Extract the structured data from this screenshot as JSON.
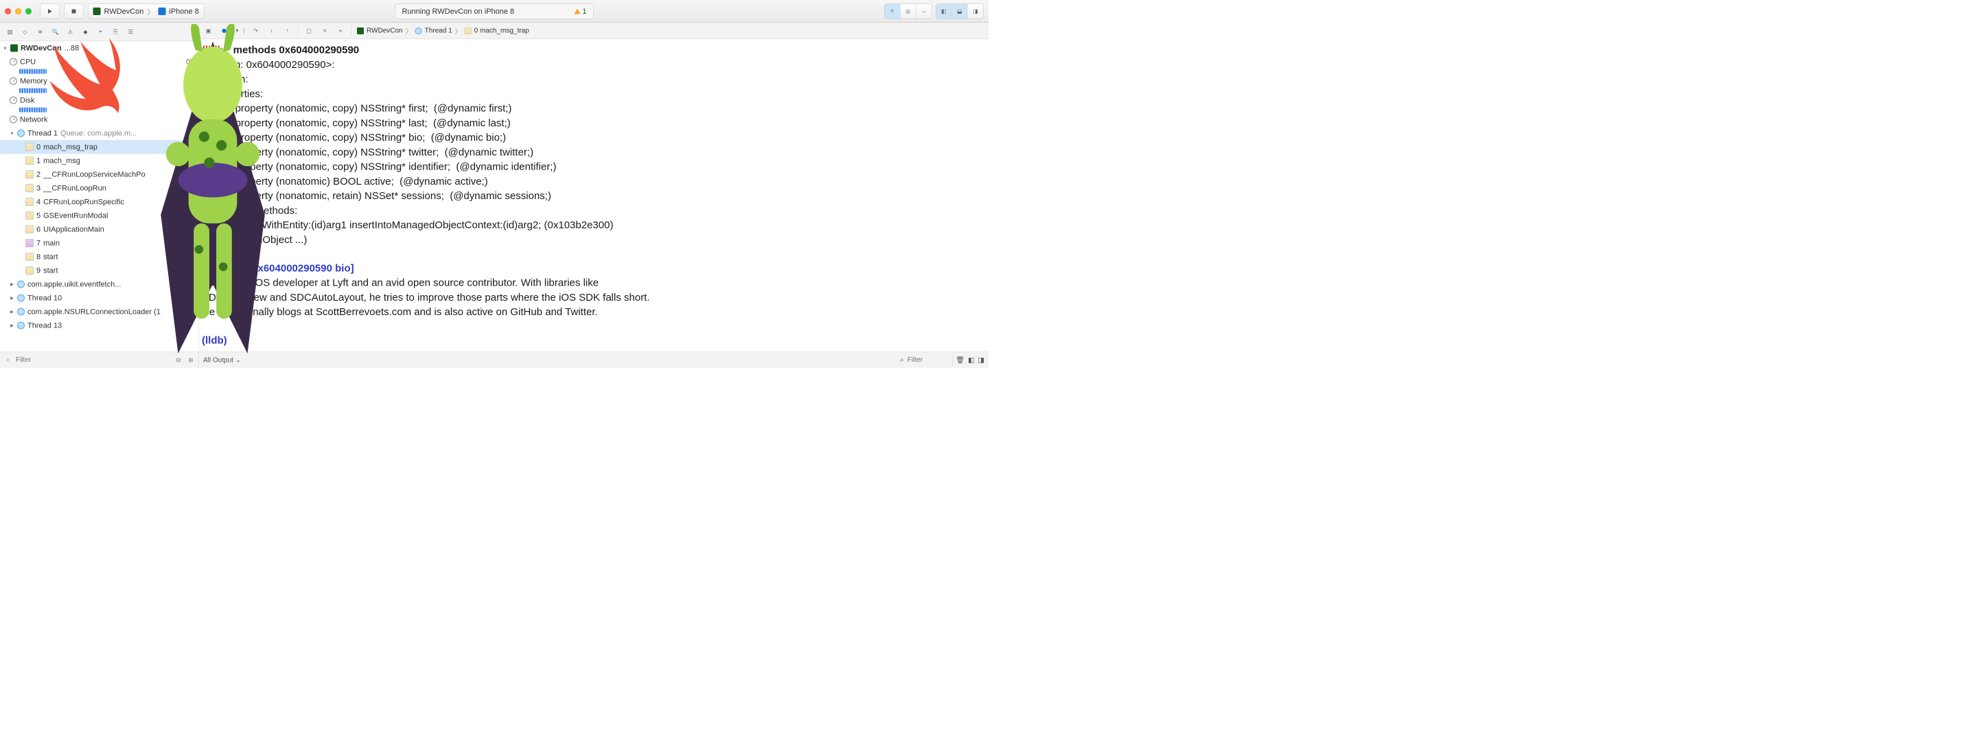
{
  "toolbar": {
    "scheme_app": "RWDevCon",
    "scheme_device": "iPhone 8",
    "activity": "Running RWDevCon on iPhone 8",
    "warning_count": "1"
  },
  "nav": {
    "root": "RWDevCon",
    "root_pid_suffix": "...88",
    "gauges": {
      "cpu": {
        "label": "CPU",
        "value": "0%"
      },
      "memory": {
        "label": "Memory",
        "value": "MB"
      },
      "disk": {
        "label": "Disk"
      },
      "network": {
        "label": "Network"
      }
    },
    "thread1": {
      "label": "Thread 1",
      "queue": "Queue: com.apple.m..."
    },
    "frames": [
      {
        "n": "0",
        "name": "mach_msg_trap",
        "sel": true,
        "user": false
      },
      {
        "n": "1",
        "name": "mach_msg",
        "user": false
      },
      {
        "n": "2",
        "name": "__CFRunLoopServiceMachPo",
        "user": false
      },
      {
        "n": "3",
        "name": "__CFRunLoopRun",
        "user": false
      },
      {
        "n": "4",
        "name": "CFRunLoopRunSpecific",
        "user": false
      },
      {
        "n": "5",
        "name": "GSEventRunModal",
        "user": false
      },
      {
        "n": "6",
        "name": "UIApplicationMain",
        "user": false
      },
      {
        "n": "7",
        "name": "main",
        "user": true
      },
      {
        "n": "8",
        "name": "start",
        "user": false
      },
      {
        "n": "9",
        "name": "start",
        "user": false
      }
    ],
    "other_threads": [
      "com.apple.uikit.eventfetch...",
      "Thread 10",
      "com.apple.NSURLConnectionLoader (1",
      "Thread 13"
    ],
    "filter_placeholder": "Filter"
  },
  "jumpbar": {
    "app": "RWDevCon",
    "thread": "Thread 1",
    "frame": "0 mach_msg_trap"
  },
  "console": {
    "prompt": "(lldb)",
    "cmd1": "methods 0x604000290590",
    "out": "<Person: 0x604000290590>:\nin Person:\n    Properties:\n        @property (nonatomic, copy) NSString* first;  (@dynamic first;)\n        @property (nonatomic, copy) NSString* last;  (@dynamic last;)\n        @property (nonatomic, copy) NSString* bio;  (@dynamic bio;)\n        @property (nonatomic, copy) NSString* twitter;  (@dynamic twitter;)\n        @property (nonatomic, copy) NSString* identifier;  (@dynamic identifier;)\n        @property (nonatomic) BOOL active;  (@dynamic active;)\n        @property (nonatomic, retain) NSSet* sessions;  (@dynamic sessions;)\n    Instance Methods:\n        - (id) initWithEntity:(id)arg1 insertIntoManagedObjectContext:(id)arg2; (0x103b2e300)\n(NSManagedObject ...)\n",
    "cmd2_prefix": "(lldb)",
    "cmd2": "po [0x604000290590 bio]",
    "bio": "Scott is an iOS developer at Lyft and an avid open source contributor. With libraries like\nSDCAlertView and SDCAutoLayout, he tries to improve those parts where the iOS SDK falls short.\nHe occasionally blogs at ScottBerrevoets.com and is also active on GitHub and Twitter.\n",
    "prompt3": "(lldb)"
  },
  "debug_footer": {
    "output_scope": "All Output",
    "filter_placeholder": "Filter"
  }
}
